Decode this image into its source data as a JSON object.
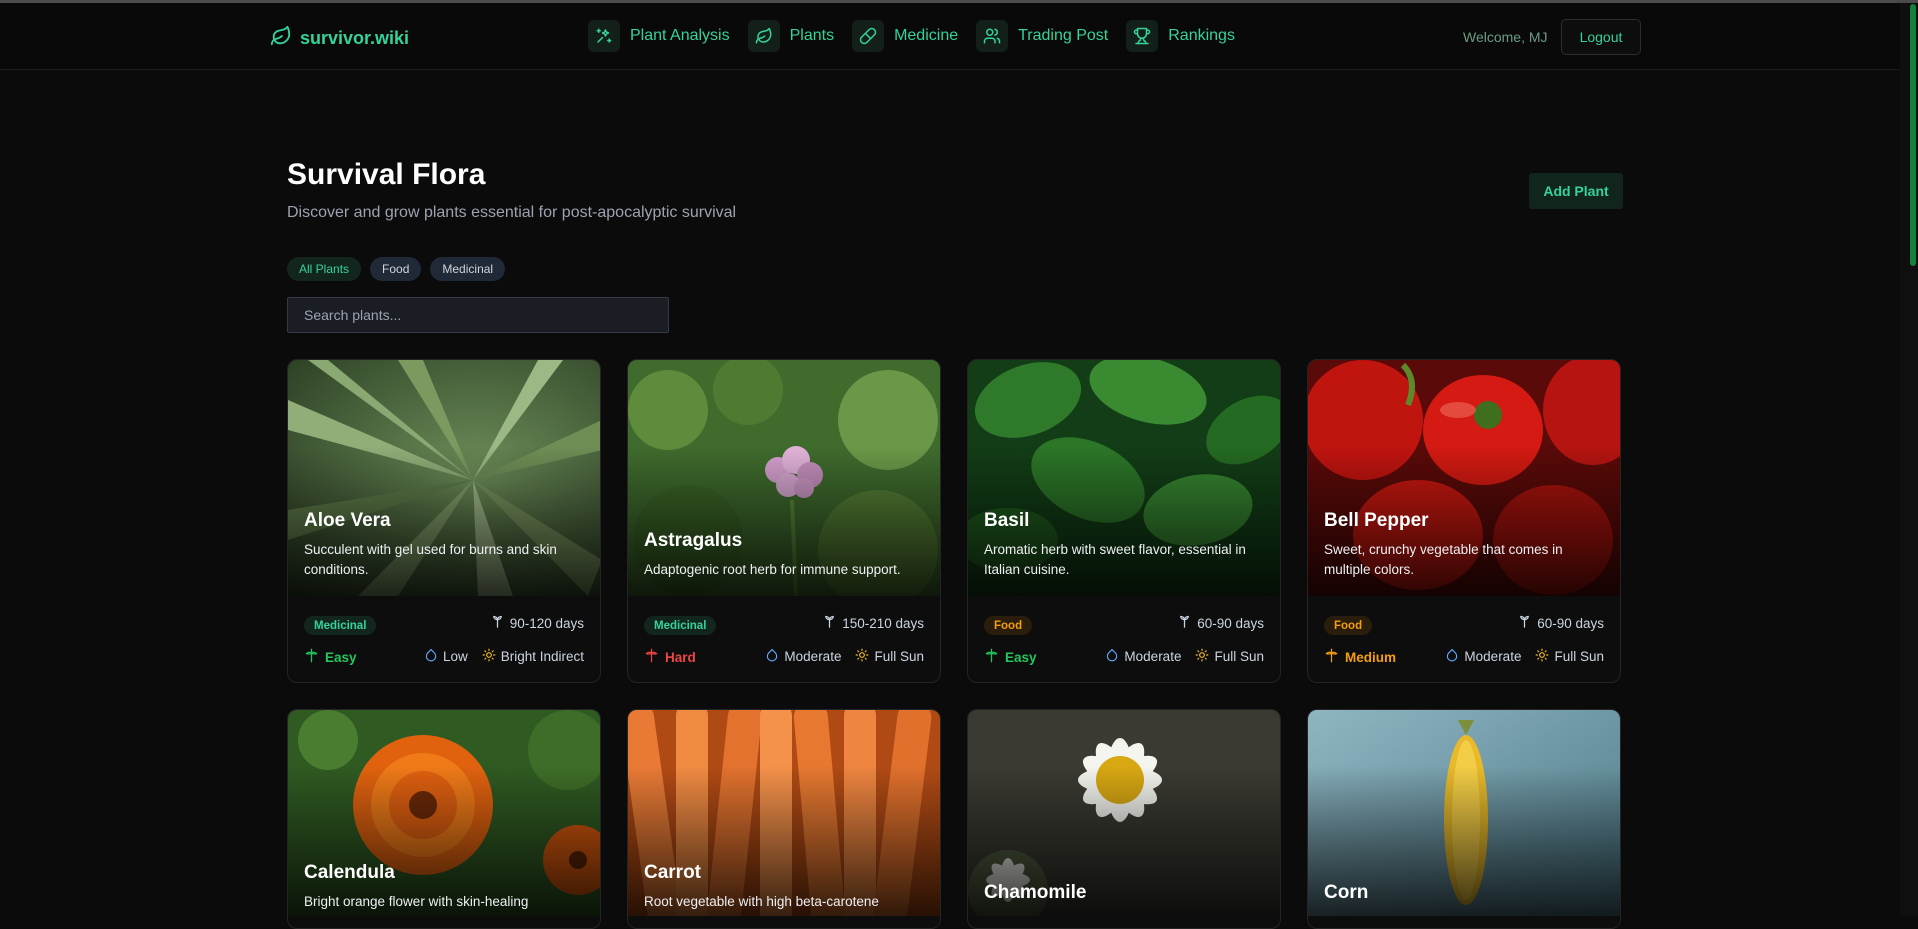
{
  "brand": {
    "name": "survivor.wiki",
    "icon": "leaf-icon",
    "color": "#34d399"
  },
  "nav": [
    {
      "label": "Plant Analysis",
      "icon": "sparkles-icon"
    },
    {
      "label": "Plants",
      "icon": "leaf-icon"
    },
    {
      "label": "Medicine",
      "icon": "pill-icon"
    },
    {
      "label": "Trading Post",
      "icon": "users-icon"
    },
    {
      "label": "Rankings",
      "icon": "trophy-icon"
    }
  ],
  "user": {
    "welcome": "Welcome, MJ",
    "logout_label": "Logout"
  },
  "page": {
    "title": "Survival Flora",
    "subtitle": "Discover and grow plants essential for post-apocalyptic survival",
    "add_button": "Add Plant"
  },
  "filters": [
    {
      "label": "All Plants",
      "active": true
    },
    {
      "label": "Food",
      "active": false
    },
    {
      "label": "Medicinal",
      "active": false
    }
  ],
  "search": {
    "placeholder": "Search plants...",
    "value": ""
  },
  "plants": [
    {
      "name": "Aloe Vera",
      "description": "Succulent with gel used for burns and skin conditions.",
      "category": "Medicinal",
      "days": "90-120 days",
      "difficulty": "Easy",
      "difficulty_color": "#22c55e",
      "water": "Low",
      "sun": "Bright Indirect"
    },
    {
      "name": "Astragalus",
      "description": "Adaptogenic root herb for immune support.",
      "category": "Medicinal",
      "days": "150-210 days",
      "difficulty": "Hard",
      "difficulty_color": "#ef4444",
      "water": "Moderate",
      "sun": "Full Sun"
    },
    {
      "name": "Basil",
      "description": "Aromatic herb with sweet flavor, essential in Italian cuisine.",
      "category": "Food",
      "days": "60-90 days",
      "difficulty": "Easy",
      "difficulty_color": "#22c55e",
      "water": "Moderate",
      "sun": "Full Sun"
    },
    {
      "name": "Bell Pepper",
      "description": "Sweet, crunchy vegetable that comes in multiple colors.",
      "category": "Food",
      "days": "60-90 days",
      "difficulty": "Medium",
      "difficulty_color": "#f59e0b",
      "water": "Moderate",
      "sun": "Full Sun"
    },
    {
      "name": "Calendula",
      "description": "Bright orange flower with skin-healing"
    },
    {
      "name": "Carrot",
      "description": "Root vegetable with high beta-carotene"
    },
    {
      "name": "Chamomile",
      "description": ""
    },
    {
      "name": "Corn",
      "description": ""
    }
  ],
  "colors": {
    "accent": "#34d399",
    "background": "#0b0b0b",
    "medicinal": "#34d399",
    "food": "#f59e0b",
    "water_icon": "#60a5fa",
    "sun_icon": "#fbbf24",
    "scrollbar": "#15803d"
  }
}
